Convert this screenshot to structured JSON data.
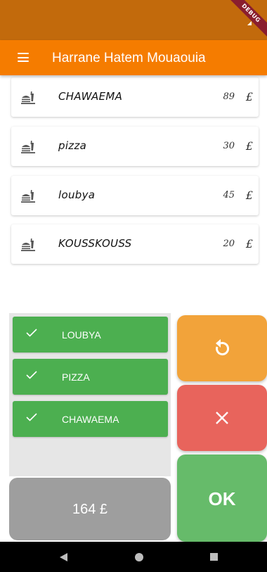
{
  "status_bar": {
    "debug_label": "DEBUG"
  },
  "app_bar": {
    "title": "Harrane Hatem Mouaouia",
    "menu_icon": "hamburger-menu-icon"
  },
  "menu": {
    "items": [
      {
        "name": "CHAWAEMA",
        "price": "89",
        "currency": "£",
        "icon": "fastfood-icon"
      },
      {
        "name": "pizza",
        "price": "30",
        "currency": "£",
        "icon": "fastfood-icon"
      },
      {
        "name": "loubya",
        "price": "45",
        "currency": "£",
        "icon": "fastfood-icon"
      },
      {
        "name": "KOUSSKOUSS",
        "price": "20",
        "currency": "£",
        "icon": "fastfood-icon"
      }
    ]
  },
  "order": {
    "items": [
      {
        "label": "LOUBYA",
        "icon": "check-icon"
      },
      {
        "label": "PIZZA",
        "icon": "check-icon"
      },
      {
        "label": "CHAWAEMA",
        "icon": "check-icon"
      }
    ],
    "total": "164 £"
  },
  "actions": {
    "reset_icon": "refresh-icon",
    "cancel_icon": "close-icon",
    "ok_label": "OK"
  },
  "colors": {
    "app_bar": "#f57c00",
    "status_bar": "#c26a0c",
    "order_item": "#4caf50",
    "reset_button": "#f2a33a",
    "cancel_button": "#e8645c",
    "ok_button": "#66bb6a",
    "total_box": "#9e9e9e"
  },
  "nav_bar": {
    "back_icon": "back-icon",
    "home_icon": "home-icon",
    "recent_icon": "recent-apps-icon"
  }
}
